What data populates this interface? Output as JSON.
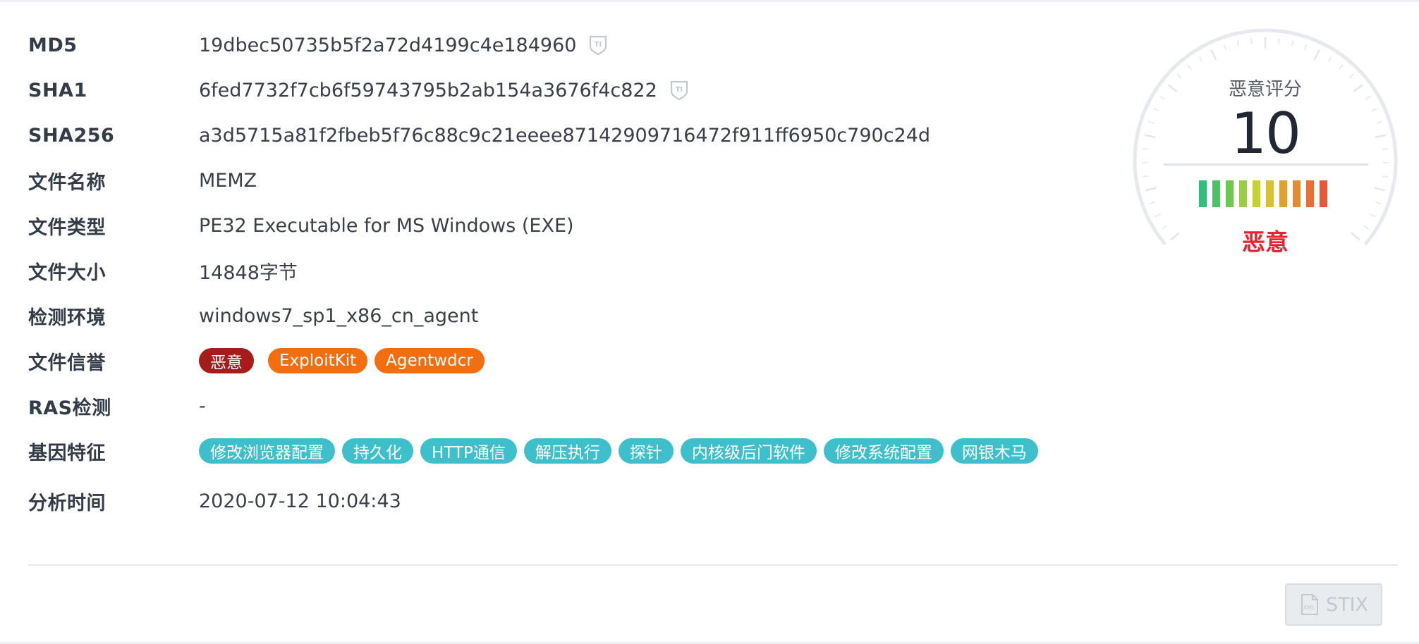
{
  "fields": {
    "md5": {
      "label": "MD5",
      "value": "19dbec50735b5f2a72d4199c4e184960"
    },
    "sha1": {
      "label": "SHA1",
      "value": "6fed7732f7cb6f59743795b2ab154a3676f4c822"
    },
    "sha256": {
      "label": "SHA256",
      "value": "a3d5715a81f2fbeb5f76c88c9c21eeee87142909716472f911ff6950c790c24d"
    },
    "file_name": {
      "label": "文件名称",
      "value": "MEMZ"
    },
    "file_type": {
      "label": "文件类型",
      "value": "PE32 Executable for MS Windows (EXE)"
    },
    "file_size": {
      "label": "文件大小",
      "value": "14848字节"
    },
    "environment": {
      "label": "检测环境",
      "value": "windows7_sp1_x86_cn_agent"
    },
    "reputation": {
      "label": "文件信誉",
      "tags": [
        "恶意",
        "ExploitKit",
        "Agentwdcr"
      ]
    },
    "ras": {
      "label": "RAS检测",
      "value": "-"
    },
    "genes": {
      "label": "基因特征",
      "tags": [
        "修改浏览器配置",
        "持久化",
        "HTTP通信",
        "解压执行",
        "探针",
        "内核级后门软件",
        "修改系统配置",
        "网银木马"
      ]
    },
    "analysis_time": {
      "label": "分析时间",
      "value": "2020-07-12 10:04:43"
    }
  },
  "ti_icon": "ti-shield-icon",
  "score": {
    "title": "恶意评分",
    "value": "10",
    "verdict": "恶意",
    "level": 10,
    "max": 10,
    "bar_colors": [
      "#2fc07a",
      "#48c460",
      "#6cc94b",
      "#98cf3a",
      "#c4d22d",
      "#d8c12a",
      "#e0a22a",
      "#e58a2e",
      "#ea6f31",
      "#ee5534"
    ],
    "verdict_color": "#e8232f"
  },
  "tag_colors": {
    "malicious": "#a61c1c",
    "orange": "#f26e0f",
    "teal": "#3ebfcc"
  },
  "stix_button": {
    "label": "STIX",
    "icon": "document-icon"
  }
}
